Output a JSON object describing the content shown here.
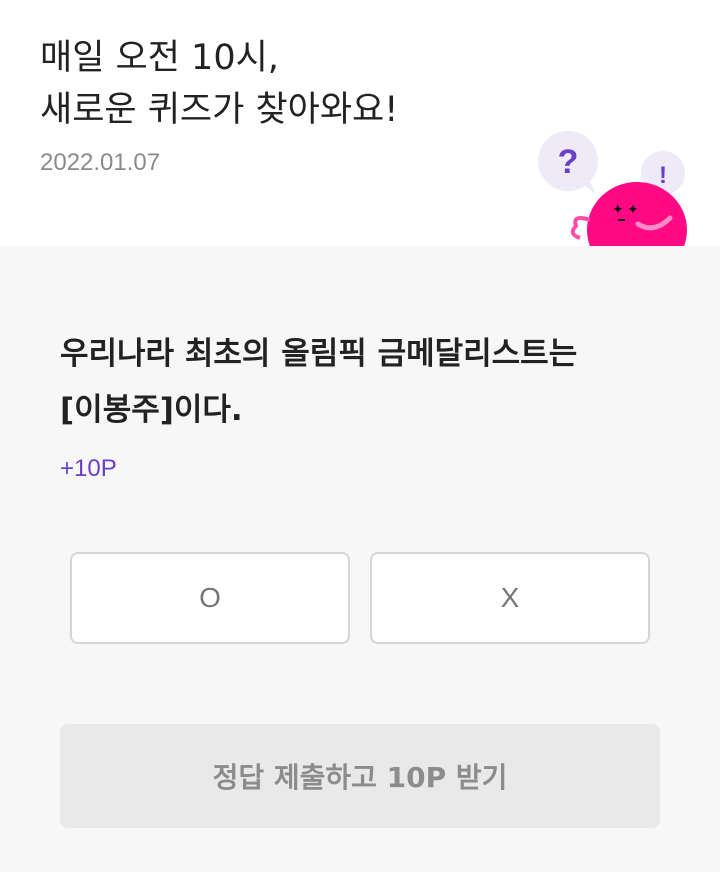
{
  "header": {
    "title_line1": "매일 오전 10시,",
    "title_line2": "새로운 퀴즈가 찾아와요!",
    "date": "2022.01.07",
    "mascot_question_mark": "?",
    "mascot_exclamation": "!"
  },
  "quiz": {
    "question_line1": "우리나라 최초의 올림픽 금메달리스트는",
    "question_line2": "[이봉주]이다.",
    "points": "+10P",
    "options": [
      {
        "label": "O"
      },
      {
        "label": "X"
      }
    ],
    "submit_label": "정답 제출하고 10P 받기"
  },
  "colors": {
    "accent_purple": "#6a3fc8",
    "mascot_pink": "#ff0a84",
    "background_gray": "#f7f7f7",
    "submit_disabled_bg": "#e9e9e9"
  },
  "icons": {
    "mascot": "pink-blob-character-icon",
    "question_bubble": "question-bubble-icon",
    "exclamation_bubble": "exclamation-bubble-icon"
  }
}
